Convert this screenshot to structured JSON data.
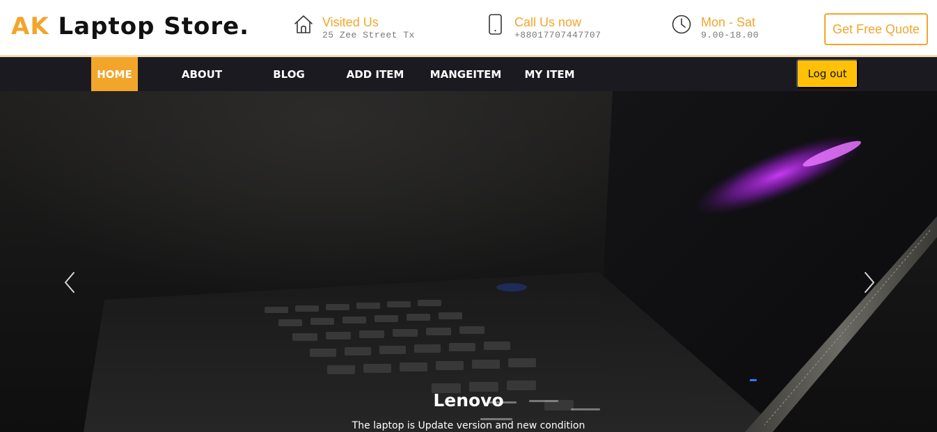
{
  "brand": {
    "prefix": "AK",
    "name": "Laptop Store."
  },
  "header": {
    "visit": {
      "title": "Visited Us",
      "subtitle": "25 Zee Street Tx",
      "icon": "home-icon"
    },
    "call": {
      "title": "Call Us now",
      "subtitle": "+88017707447707",
      "icon": "phone-icon"
    },
    "hours": {
      "title": "Mon - Sat",
      "subtitle": "9.00-18.00",
      "icon": "clock-icon"
    },
    "quote_label": "Get Free Quote"
  },
  "nav": {
    "items": [
      {
        "label": "HOME",
        "active": true
      },
      {
        "label": "ABOUT",
        "active": false
      },
      {
        "label": "BLOG",
        "active": false
      },
      {
        "label": "ADD ITEM",
        "active": false
      },
      {
        "label": "MANGEITEM",
        "active": false
      },
      {
        "label": "MY ITEM",
        "active": false
      }
    ],
    "logout_label": "Log out"
  },
  "hero": {
    "title": "Lenovo",
    "text": "The laptop is Update version and new condition",
    "prev_icon": "chevron-left-icon",
    "next_icon": "chevron-right-icon"
  },
  "colors": {
    "accent": "#f3a52b",
    "nav_bg": "#1b1a21",
    "logout_bg": "#ffc107",
    "text_dark": "#111111",
    "muted": "#777777"
  }
}
